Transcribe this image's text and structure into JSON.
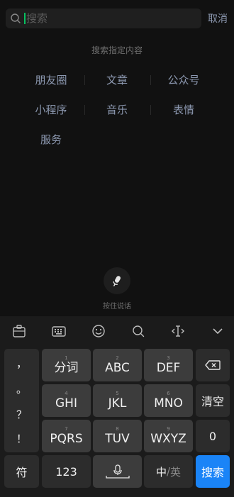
{
  "search": {
    "placeholder": "搜索",
    "cancel_label": "取消"
  },
  "filter": {
    "title": "搜索指定内容",
    "items": [
      "朋友圈",
      "文章",
      "公众号",
      "小程序",
      "音乐",
      "表情",
      "服务"
    ]
  },
  "voice": {
    "label": "按住说话"
  },
  "keyboard": {
    "toolbar_icons": [
      "clipboard-icon",
      "keyboard-icon",
      "emoji-icon",
      "search-icon",
      "cursor-move-icon",
      "collapse-icon"
    ],
    "punctuation": [
      "，",
      "。",
      "？",
      "！"
    ],
    "keys": [
      {
        "sub": "1",
        "label": "分词"
      },
      {
        "sub": "2",
        "label": "ABC"
      },
      {
        "sub": "3",
        "label": "DEF"
      },
      {
        "sub": "4",
        "label": "GHI"
      },
      {
        "sub": "5",
        "label": "JKL"
      },
      {
        "sub": "6",
        "label": "MNO"
      },
      {
        "sub": "7",
        "label": "PQRS"
      },
      {
        "sub": "8",
        "label": "TUV"
      },
      {
        "sub": "9",
        "label": "WXYZ"
      }
    ],
    "clear_label": "清空",
    "zero_label": "0",
    "symbol_label": "符",
    "num_label": "123",
    "mode_zh": "中",
    "mode_sep": "/",
    "mode_en": "英",
    "search_label": "搜索"
  },
  "colors": {
    "accent_green": "#07c160",
    "link_blue": "#8c98b0",
    "search_key_blue": "#1a84f7"
  }
}
